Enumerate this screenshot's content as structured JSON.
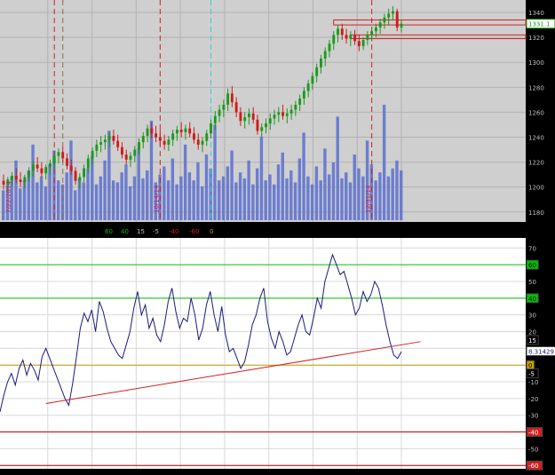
{
  "chart_data": [
    {
      "type": "candlestick",
      "ylim": [
        1172,
        1350
      ],
      "grid": true,
      "y_ticks": [
        "1340",
        "1320",
        "1300",
        "1280",
        "1260",
        "1240",
        "1220",
        "1200",
        "1180"
      ],
      "current_price_label": "1331.1",
      "date_labels": [
        "7/22/2014",
        "10/14/14",
        "12/31/14"
      ],
      "candles": [
        {
          "t": 0,
          "o": 1205,
          "h": 1210,
          "l": 1198,
          "c": 1202
        },
        {
          "t": 1,
          "o": 1202,
          "h": 1208,
          "l": 1196,
          "c": 1206
        },
        {
          "t": 2,
          "o": 1206,
          "h": 1212,
          "l": 1201,
          "c": 1209
        },
        {
          "t": 3,
          "o": 1209,
          "h": 1215,
          "l": 1203,
          "c": 1206
        },
        {
          "t": 4,
          "o": 1206,
          "h": 1212,
          "l": 1200,
          "c": 1204
        },
        {
          "t": 5,
          "o": 1204,
          "h": 1210,
          "l": 1199,
          "c": 1208
        },
        {
          "t": 6,
          "o": 1208,
          "h": 1216,
          "l": 1204,
          "c": 1213
        },
        {
          "t": 7,
          "o": 1213,
          "h": 1221,
          "l": 1208,
          "c": 1218
        },
        {
          "t": 8,
          "o": 1218,
          "h": 1224,
          "l": 1212,
          "c": 1215
        },
        {
          "t": 9,
          "o": 1215,
          "h": 1220,
          "l": 1208,
          "c": 1211
        },
        {
          "t": 10,
          "o": 1211,
          "h": 1218,
          "l": 1206,
          "c": 1216
        },
        {
          "t": 11,
          "o": 1216,
          "h": 1222,
          "l": 1210,
          "c": 1219
        },
        {
          "t": 12,
          "o": 1219,
          "h": 1228,
          "l": 1214,
          "c": 1225
        },
        {
          "t": 13,
          "o": 1225,
          "h": 1231,
          "l": 1219,
          "c": 1228
        },
        {
          "t": 14,
          "o": 1228,
          "h": 1232,
          "l": 1220,
          "c": 1223
        },
        {
          "t": 15,
          "o": 1223,
          "h": 1227,
          "l": 1214,
          "c": 1217
        },
        {
          "t": 16,
          "o": 1217,
          "h": 1222,
          "l": 1210,
          "c": 1213
        },
        {
          "t": 17,
          "o": 1213,
          "h": 1216,
          "l": 1202,
          "c": 1205
        },
        {
          "t": 18,
          "o": 1205,
          "h": 1211,
          "l": 1199,
          "c": 1208
        },
        {
          "t": 19,
          "o": 1208,
          "h": 1218,
          "l": 1204,
          "c": 1215
        },
        {
          "t": 20,
          "o": 1215,
          "h": 1226,
          "l": 1211,
          "c": 1223
        },
        {
          "t": 21,
          "o": 1223,
          "h": 1232,
          "l": 1218,
          "c": 1229
        },
        {
          "t": 22,
          "o": 1229,
          "h": 1238,
          "l": 1224,
          "c": 1234
        },
        {
          "t": 23,
          "o": 1234,
          "h": 1241,
          "l": 1228,
          "c": 1236
        },
        {
          "t": 24,
          "o": 1236,
          "h": 1242,
          "l": 1230,
          "c": 1238
        },
        {
          "t": 25,
          "o": 1238,
          "h": 1244,
          "l": 1232,
          "c": 1241
        },
        {
          "t": 26,
          "o": 1241,
          "h": 1246,
          "l": 1234,
          "c": 1237
        },
        {
          "t": 27,
          "o": 1237,
          "h": 1242,
          "l": 1229,
          "c": 1232
        },
        {
          "t": 28,
          "o": 1232,
          "h": 1236,
          "l": 1223,
          "c": 1226
        },
        {
          "t": 29,
          "o": 1226,
          "h": 1230,
          "l": 1218,
          "c": 1222
        },
        {
          "t": 30,
          "o": 1222,
          "h": 1228,
          "l": 1216,
          "c": 1225
        },
        {
          "t": 31,
          "o": 1225,
          "h": 1233,
          "l": 1220,
          "c": 1230
        },
        {
          "t": 32,
          "o": 1230,
          "h": 1239,
          "l": 1226,
          "c": 1236
        },
        {
          "t": 33,
          "o": 1236,
          "h": 1244,
          "l": 1231,
          "c": 1241
        },
        {
          "t": 34,
          "o": 1241,
          "h": 1250,
          "l": 1236,
          "c": 1247
        },
        {
          "t": 35,
          "o": 1247,
          "h": 1252,
          "l": 1239,
          "c": 1243
        },
        {
          "t": 36,
          "o": 1243,
          "h": 1249,
          "l": 1236,
          "c": 1240
        },
        {
          "t": 37,
          "o": 1240,
          "h": 1246,
          "l": 1233,
          "c": 1237
        },
        {
          "t": 38,
          "o": 1237,
          "h": 1242,
          "l": 1230,
          "c": 1234
        },
        {
          "t": 39,
          "o": 1234,
          "h": 1241,
          "l": 1229,
          "c": 1238
        },
        {
          "t": 40,
          "o": 1238,
          "h": 1246,
          "l": 1233,
          "c": 1243
        },
        {
          "t": 41,
          "o": 1243,
          "h": 1249,
          "l": 1237,
          "c": 1246
        },
        {
          "t": 42,
          "o": 1246,
          "h": 1252,
          "l": 1240,
          "c": 1244
        },
        {
          "t": 43,
          "o": 1244,
          "h": 1250,
          "l": 1238,
          "c": 1247
        },
        {
          "t": 44,
          "o": 1247,
          "h": 1252,
          "l": 1240,
          "c": 1243
        },
        {
          "t": 45,
          "o": 1243,
          "h": 1248,
          "l": 1235,
          "c": 1238
        },
        {
          "t": 46,
          "o": 1238,
          "h": 1243,
          "l": 1230,
          "c": 1234
        },
        {
          "t": 47,
          "o": 1234,
          "h": 1240,
          "l": 1228,
          "c": 1237
        },
        {
          "t": 48,
          "o": 1237,
          "h": 1246,
          "l": 1233,
          "c": 1243
        },
        {
          "t": 49,
          "o": 1243,
          "h": 1254,
          "l": 1239,
          "c": 1251
        },
        {
          "t": 50,
          "o": 1251,
          "h": 1261,
          "l": 1246,
          "c": 1257
        },
        {
          "t": 51,
          "o": 1257,
          "h": 1266,
          "l": 1252,
          "c": 1262
        },
        {
          "t": 52,
          "o": 1262,
          "h": 1270,
          "l": 1256,
          "c": 1266
        },
        {
          "t": 53,
          "o": 1266,
          "h": 1279,
          "l": 1261,
          "c": 1275
        },
        {
          "t": 54,
          "o": 1275,
          "h": 1281,
          "l": 1264,
          "c": 1268
        },
        {
          "t": 55,
          "o": 1268,
          "h": 1272,
          "l": 1256,
          "c": 1260
        },
        {
          "t": 56,
          "o": 1260,
          "h": 1264,
          "l": 1249,
          "c": 1253
        },
        {
          "t": 57,
          "o": 1253,
          "h": 1260,
          "l": 1247,
          "c": 1256
        },
        {
          "t": 58,
          "o": 1256,
          "h": 1263,
          "l": 1250,
          "c": 1259
        },
        {
          "t": 59,
          "o": 1259,
          "h": 1264,
          "l": 1251,
          "c": 1254
        },
        {
          "t": 60,
          "o": 1254,
          "h": 1258,
          "l": 1242,
          "c": 1245
        },
        {
          "t": 61,
          "o": 1245,
          "h": 1251,
          "l": 1240,
          "c": 1248
        },
        {
          "t": 62,
          "o": 1248,
          "h": 1255,
          "l": 1243,
          "c": 1251
        },
        {
          "t": 63,
          "o": 1251,
          "h": 1259,
          "l": 1246,
          "c": 1255
        },
        {
          "t": 64,
          "o": 1255,
          "h": 1262,
          "l": 1250,
          "c": 1258
        },
        {
          "t": 65,
          "o": 1258,
          "h": 1264,
          "l": 1252,
          "c": 1260
        },
        {
          "t": 66,
          "o": 1260,
          "h": 1266,
          "l": 1254,
          "c": 1257
        },
        {
          "t": 67,
          "o": 1257,
          "h": 1263,
          "l": 1251,
          "c": 1259
        },
        {
          "t": 68,
          "o": 1259,
          "h": 1266,
          "l": 1254,
          "c": 1262
        },
        {
          "t": 69,
          "o": 1262,
          "h": 1269,
          "l": 1257,
          "c": 1266
        },
        {
          "t": 70,
          "o": 1266,
          "h": 1274,
          "l": 1261,
          "c": 1271
        },
        {
          "t": 71,
          "o": 1271,
          "h": 1280,
          "l": 1266,
          "c": 1277
        },
        {
          "t": 72,
          "o": 1277,
          "h": 1286,
          "l": 1272,
          "c": 1283
        },
        {
          "t": 73,
          "o": 1283,
          "h": 1292,
          "l": 1278,
          "c": 1289
        },
        {
          "t": 74,
          "o": 1289,
          "h": 1299,
          "l": 1284,
          "c": 1296
        },
        {
          "t": 75,
          "o": 1296,
          "h": 1306,
          "l": 1291,
          "c": 1303
        },
        {
          "t": 76,
          "o": 1303,
          "h": 1312,
          "l": 1297,
          "c": 1309
        },
        {
          "t": 77,
          "o": 1309,
          "h": 1318,
          "l": 1304,
          "c": 1315
        },
        {
          "t": 78,
          "o": 1315,
          "h": 1325,
          "l": 1310,
          "c": 1322
        },
        {
          "t": 79,
          "o": 1322,
          "h": 1330,
          "l": 1316,
          "c": 1327
        },
        {
          "t": 80,
          "o": 1327,
          "h": 1331,
          "l": 1318,
          "c": 1322
        },
        {
          "t": 81,
          "o": 1322,
          "h": 1327,
          "l": 1315,
          "c": 1319
        },
        {
          "t": 82,
          "o": 1319,
          "h": 1325,
          "l": 1313,
          "c": 1322
        },
        {
          "t": 83,
          "o": 1322,
          "h": 1326,
          "l": 1314,
          "c": 1317
        },
        {
          "t": 84,
          "o": 1317,
          "h": 1322,
          "l": 1309,
          "c": 1313
        },
        {
          "t": 85,
          "o": 1313,
          "h": 1320,
          "l": 1310,
          "c": 1318
        },
        {
          "t": 86,
          "o": 1318,
          "h": 1325,
          "l": 1314,
          "c": 1322
        },
        {
          "t": 87,
          "o": 1322,
          "h": 1328,
          "l": 1317,
          "c": 1325
        },
        {
          "t": 88,
          "o": 1325,
          "h": 1331,
          "l": 1320,
          "c": 1328
        },
        {
          "t": 89,
          "o": 1328,
          "h": 1335,
          "l": 1323,
          "c": 1332
        },
        {
          "t": 90,
          "o": 1332,
          "h": 1339,
          "l": 1327,
          "c": 1336
        },
        {
          "t": 91,
          "o": 1336,
          "h": 1343,
          "l": 1330,
          "c": 1339
        },
        {
          "t": 92,
          "o": 1339,
          "h": 1345,
          "l": 1334,
          "c": 1341
        },
        {
          "t": 93,
          "o": 1341,
          "h": 1343,
          "l": 1325,
          "c": 1328
        },
        {
          "t": 94,
          "o": 1328,
          "h": 1334,
          "l": 1324,
          "c": 1331
        }
      ],
      "volume": [
        15,
        18,
        22,
        30,
        16,
        20,
        25,
        38,
        19,
        22,
        17,
        28,
        35,
        20,
        18,
        24,
        40,
        15,
        21,
        19,
        26,
        32,
        18,
        22,
        30,
        45,
        20,
        19,
        24,
        28,
        17,
        22,
        36,
        21,
        25,
        50,
        19,
        23,
        27,
        20,
        31,
        18,
        22,
        38,
        24,
        20,
        29,
        17,
        33,
        26,
        48,
        20,
        22,
        27,
        35,
        19,
        24,
        21,
        30,
        18,
        26,
        42,
        20,
        23,
        18,
        28,
        34,
        21,
        25,
        19,
        31,
        44,
        22,
        18,
        27,
        20,
        36,
        23,
        29,
        52,
        21,
        24,
        19,
        33,
        26,
        22,
        40,
        28,
        20,
        24,
        58,
        22,
        26,
        30,
        25
      ]
    },
    {
      "type": "line",
      "ylim": [
        -62,
        76
      ],
      "y_ticks": [
        "70",
        "50",
        "40",
        "30",
        "20",
        "10",
        "0",
        "-10",
        "-20",
        "-30",
        "-40",
        "-50",
        "-60"
      ],
      "legend": [
        "60",
        "40",
        "15",
        "-5",
        "-40",
        "-60",
        "0"
      ],
      "right_labels": [
        "60",
        "40",
        "15",
        "8.31429",
        "0",
        "-5",
        "-40",
        "-60"
      ],
      "levels": [
        {
          "value": 60,
          "color": "#00c000"
        },
        {
          "value": 40,
          "color": "#00c000"
        },
        {
          "value": 0,
          "color": "#c8a000"
        },
        {
          "value": -40,
          "color": "#c00000"
        },
        {
          "value": -60,
          "color": "#c00000"
        }
      ],
      "trendline": [
        {
          "t": 12,
          "v": -23
        },
        {
          "t": 110,
          "v": 14
        }
      ],
      "values": [
        -28,
        -18,
        -10,
        -5,
        -12,
        -2,
        3,
        -6,
        1,
        -3,
        -9,
        5,
        10,
        4,
        -2,
        -8,
        -14,
        -20,
        -24,
        -11,
        5,
        22,
        31,
        26,
        33,
        20,
        38,
        32,
        22,
        14,
        10,
        6,
        4,
        12,
        20,
        34,
        44,
        30,
        36,
        22,
        28,
        18,
        14,
        24,
        38,
        46,
        32,
        22,
        28,
        26,
        40,
        30,
        15,
        22,
        36,
        44,
        30,
        20,
        35,
        18,
        8,
        10,
        4,
        -2,
        2,
        12,
        24,
        30,
        40,
        46,
        26,
        16,
        10,
        20,
        14,
        6,
        8,
        16,
        24,
        30,
        20,
        18,
        28,
        40,
        34,
        50,
        58,
        66,
        60,
        54,
        56,
        48,
        40,
        30,
        34,
        44,
        38,
        42,
        50,
        46,
        36,
        24,
        14,
        6,
        4,
        8
      ]
    }
  ]
}
